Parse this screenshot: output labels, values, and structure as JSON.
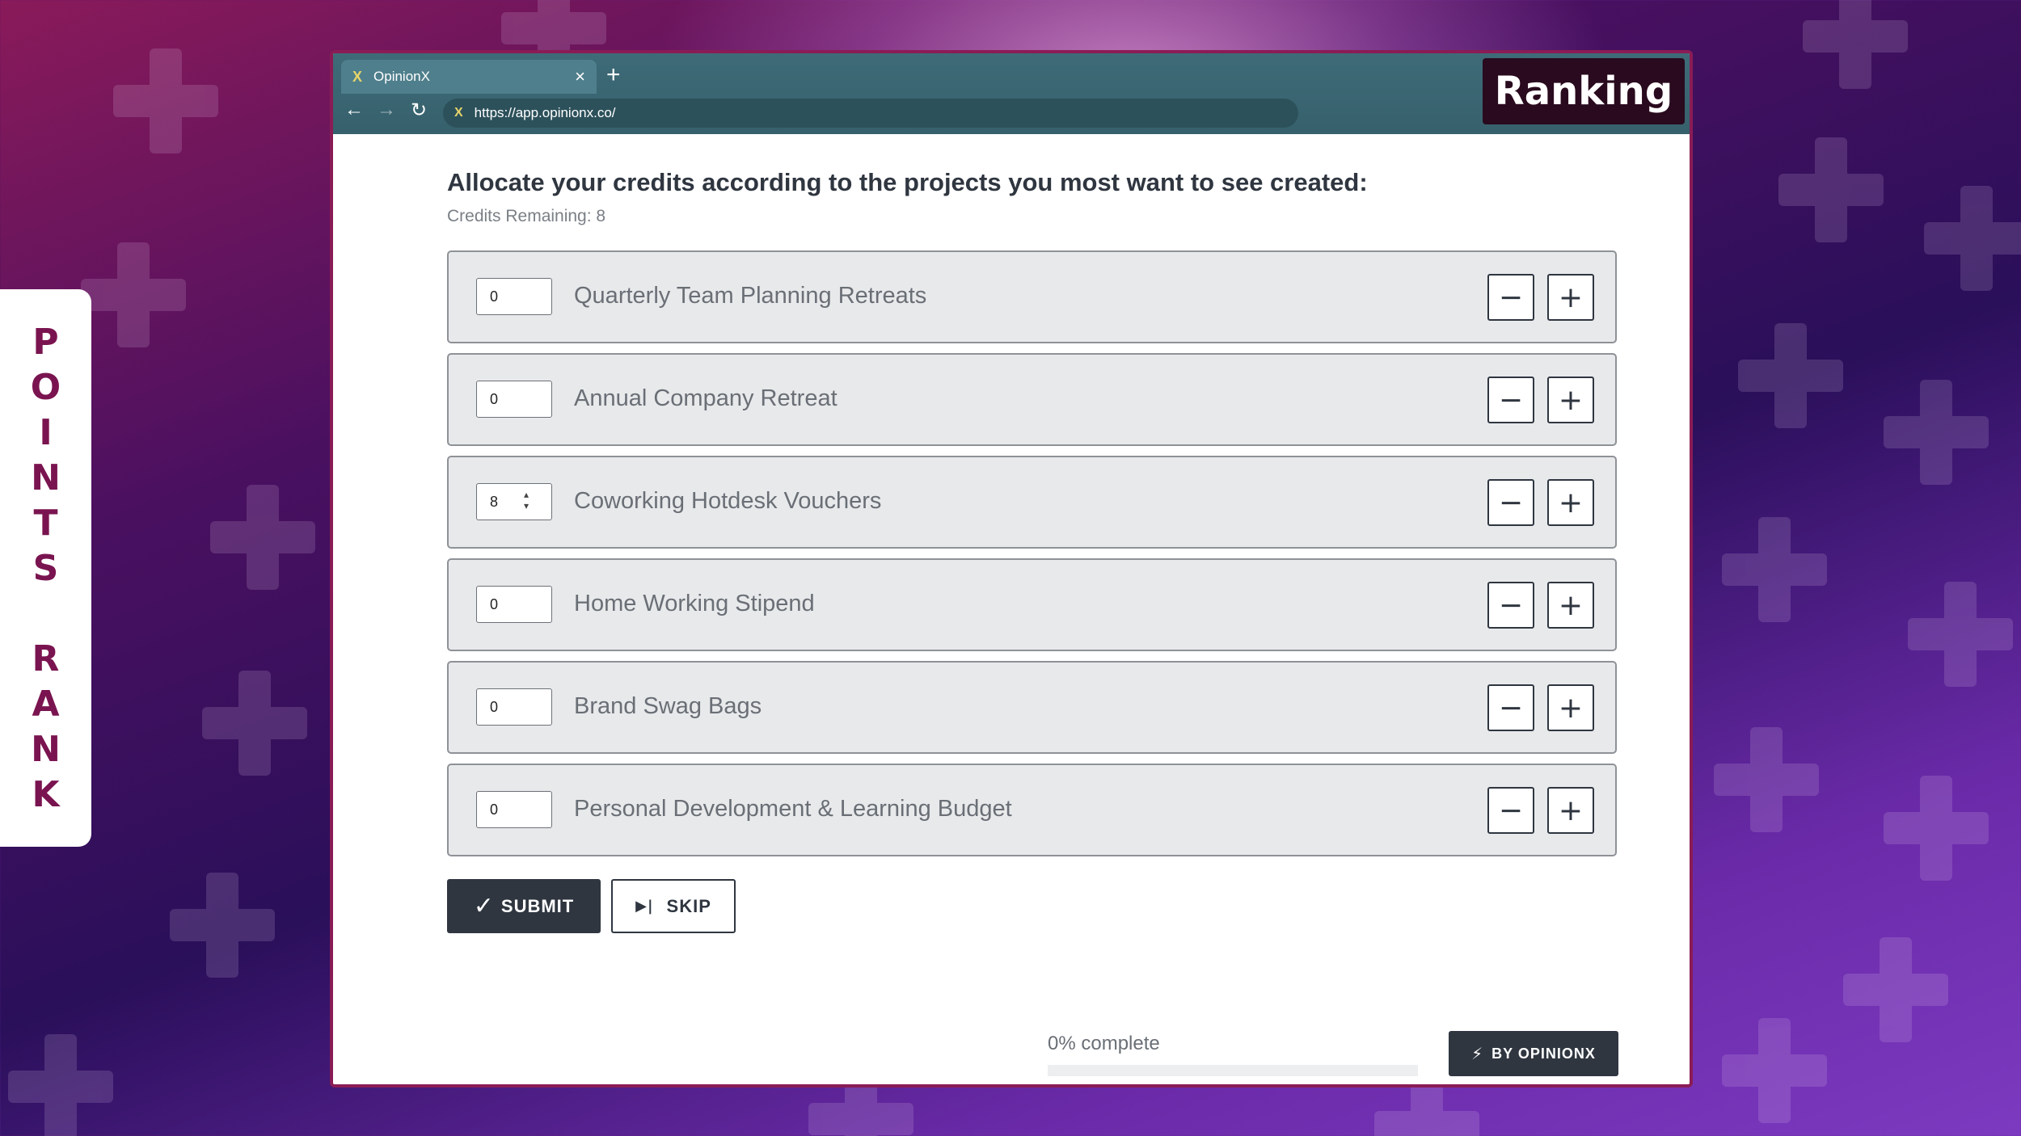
{
  "side_label": {
    "letters": [
      "P",
      "O",
      "I",
      "N",
      "T",
      "S",
      "",
      "R",
      "A",
      "N",
      "K"
    ]
  },
  "badge": "Ranking",
  "browser": {
    "tab_title": "OpinionX",
    "tab_close": "×",
    "new_tab": "+",
    "url": "https://app.opinionx.co/",
    "favicon": "X"
  },
  "page": {
    "heading": "Allocate your credits according to the projects you most want to see created:",
    "credits_remaining": "Credits Remaining: 8"
  },
  "items": [
    {
      "value": "0",
      "label": "Quarterly Team Planning Retreats"
    },
    {
      "value": "0",
      "label": "Annual Company Retreat"
    },
    {
      "value": "8",
      "label": "Coworking Hotdesk Vouchers"
    },
    {
      "value": "0",
      "label": "Home Working Stipend"
    },
    {
      "value": "0",
      "label": "Brand Swag Bags"
    },
    {
      "value": "0",
      "label": "Personal Development & Learning Budget"
    }
  ],
  "buttons": {
    "minus": "−",
    "plus": "+",
    "submit": "SUBMIT",
    "skip": "SKIP"
  },
  "progress": {
    "label": "0% complete",
    "value": 0
  },
  "footer": {
    "by_label": "BY OPINIONX"
  },
  "colors": {
    "accent": "#2f3640",
    "brand": "#8a1c55"
  }
}
